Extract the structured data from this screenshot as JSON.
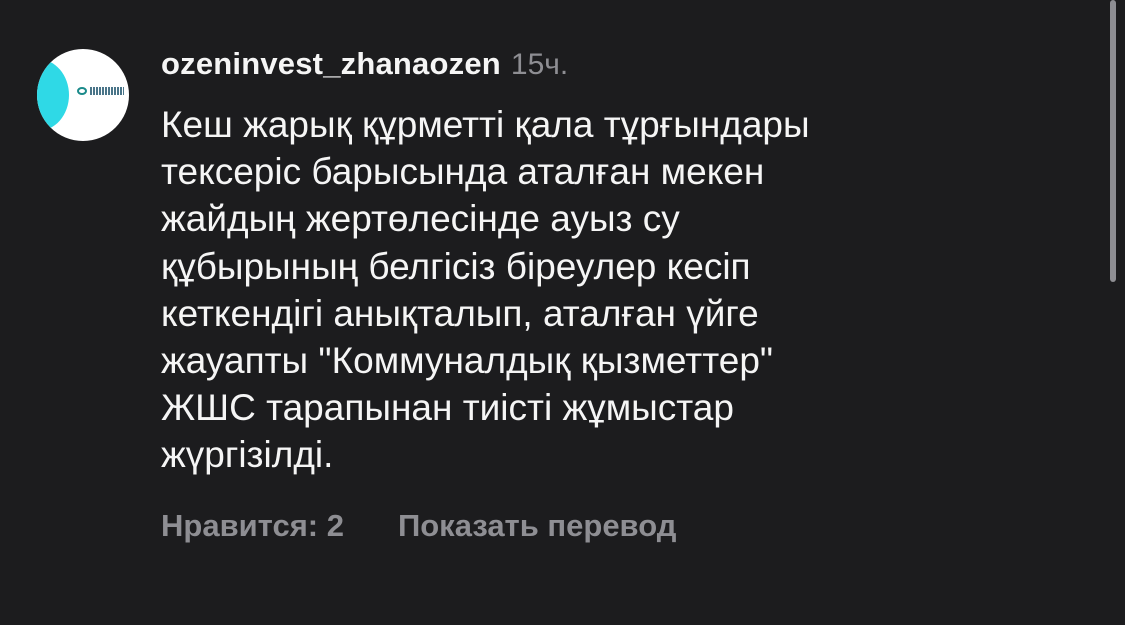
{
  "comment": {
    "username": "ozeninvest_zhanaozen",
    "timestamp": "15ч.",
    "body_lines": [
      "Кеш жарық құрметті қала тұрғындары",
      "тексеріс барысында аталған мекен",
      "жайдың жертөлесінде ауыз су",
      "құбырының белгісіз біреулер кесіп",
      "кеткендігі анықталып, аталған үйге",
      "жауапты \"Коммуналдық қызметтер\"",
      "ЖШС тарапынан тиісті жұмыстар",
      "жүргізілді."
    ],
    "likes_label": "Нравится: 2",
    "translate_label": "Показать перевод",
    "avatar_logo_text": "ӨЗЕНИНВЕСТ"
  },
  "colors": {
    "background": "#1c1c1e",
    "primary_text": "#f5f5f5",
    "secondary_text": "#8e8e93",
    "avatar_accent": "#2fd9e6"
  }
}
